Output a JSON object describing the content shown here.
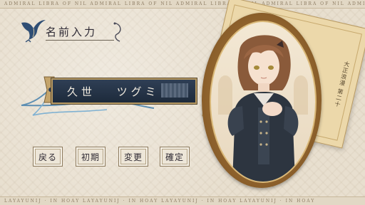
{
  "screen": {
    "title": "名前入力",
    "header_strip_text": "ADMIRAL LIBRA OF NIL ADMIRAL LIBRA OF NIL ADMIRAL LIBRA OF NIL ADMIRAL LIBRA OF NIL ADMIRAL",
    "footer_strip_text": "LAYAYUNIJ · IN HOAY LAYAYUNIJ · IN HOAY LAYAYUNIJ · IN HOAY LAYAYUNIJ · IN HOAY"
  },
  "name_input": {
    "family_name": "久世",
    "given_name": "ツグミ"
  },
  "buttons": {
    "back": "戻る",
    "reset": "初期",
    "change": "変更",
    "confirm": "確定"
  },
  "postcard": {
    "text": "大正浪漫 第二十"
  },
  "icons": {
    "title_icon": "swallow-bird-icon",
    "ribbon": "blue-ribbon-decoration"
  },
  "colors": {
    "name_bar": "#1d2a3b",
    "accent_gold": "#b79a63",
    "background": "#e8dfcf"
  }
}
